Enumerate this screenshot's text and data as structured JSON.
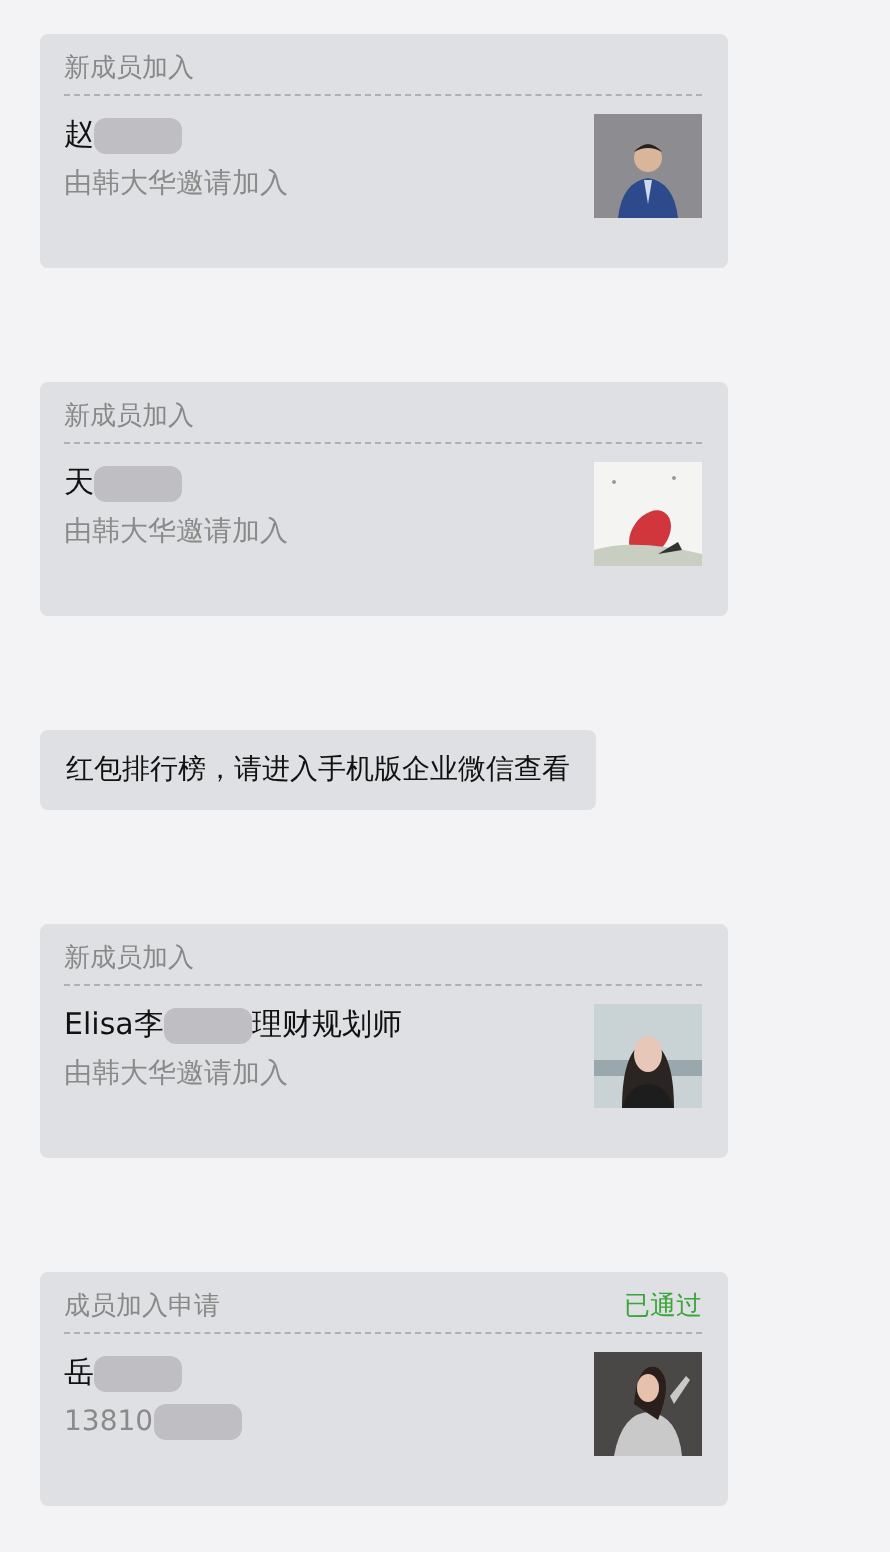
{
  "messages": [
    {
      "kind": "card",
      "header": "新成员加入",
      "name": [
        {
          "kind": "text",
          "text": "赵"
        },
        {
          "kind": "redacted"
        }
      ],
      "detail": [
        {
          "kind": "text",
          "text": "由韩大华邀请加入"
        }
      ]
    },
    {
      "kind": "card",
      "header": "新成员加入",
      "name": [
        {
          "kind": "text",
          "text": "天"
        },
        {
          "kind": "redacted"
        }
      ],
      "detail": [
        {
          "kind": "text",
          "text": "由韩大华邀请加入"
        }
      ]
    },
    {
      "kind": "text",
      "text": "红包排行榜，请进入手机版企业微信查看"
    },
    {
      "kind": "card",
      "header": "新成员加入",
      "name": [
        {
          "kind": "text",
          "text": "Elisa李"
        },
        {
          "kind": "redacted"
        },
        {
          "kind": "text",
          "text": "理财规划师"
        }
      ],
      "detail": [
        {
          "kind": "text",
          "text": "由韩大华邀请加入"
        }
      ]
    },
    {
      "kind": "card",
      "header": "成员加入申请",
      "status": "已通过",
      "name": [
        {
          "kind": "text",
          "text": "岳"
        },
        {
          "kind": "redacted"
        }
      ],
      "detail": [
        {
          "kind": "text",
          "text": "13810"
        },
        {
          "kind": "redacted"
        }
      ]
    }
  ]
}
